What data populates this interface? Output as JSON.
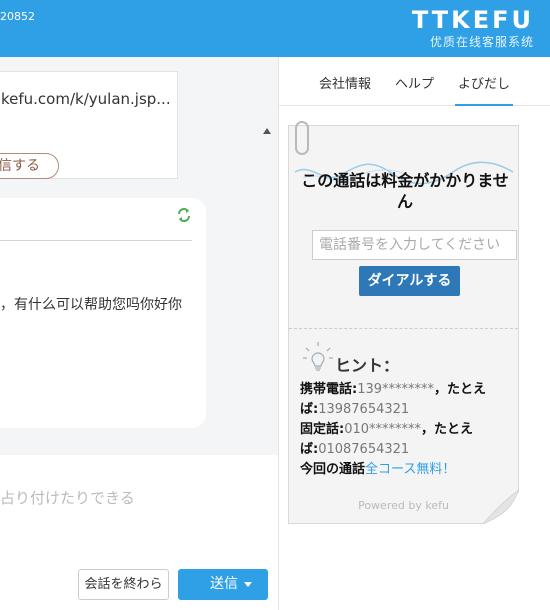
{
  "header": {
    "number": "20852",
    "brand": "TTKEFU",
    "subtitle": "优质在线客服系统"
  },
  "chat": {
    "link_text": "kefu.com/k/yulan.jsp...",
    "card_button": "信する",
    "message": "，有什么可以帮助您吗你好你",
    "input_placeholder": "占り付けたりできる",
    "end_button": "会話を終わら",
    "send_button": "送信"
  },
  "sidebar": {
    "tabs": [
      {
        "label": "会社情報"
      },
      {
        "label": "ヘルプ"
      },
      {
        "label": "よびだし"
      }
    ],
    "active_tab": "よびだし",
    "call_title": "この通話は料金がかかりません",
    "phone_placeholder": "電話番号を入力してください",
    "dial_button": "ダイアルする",
    "hint_title": "ヒント：",
    "mobile_label": "携帯電話:",
    "mobile_value": "139********",
    "example_label": "，たとえば:",
    "mobile_example": "13987654321",
    "landline_label": "固定話:",
    "landline_value": "010********",
    "landline_example": "01087654321",
    "free_prefix": "今回の通話",
    "free_text": "全コース無料！",
    "powered": "Powered by kefu"
  },
  "colors": {
    "accent": "#2f9fe6",
    "dial": "#2e78b8"
  }
}
